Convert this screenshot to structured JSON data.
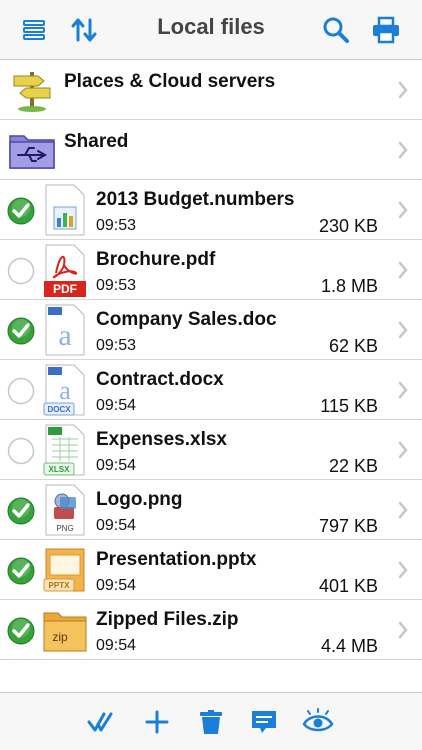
{
  "header": {
    "title": "Local files",
    "left_buttons": [
      "menu-icon",
      "sort-icon"
    ],
    "right_buttons": [
      "search-icon",
      "print-icon"
    ]
  },
  "places": [
    {
      "label": "Places & Cloud servers",
      "icon": "signpost-icon"
    },
    {
      "label": "Shared",
      "icon": "usb-folder-icon"
    }
  ],
  "files": [
    {
      "name": "2013 Budget.numbers",
      "time": "09:53",
      "size": "230 KB",
      "selected": true,
      "type": "numbers"
    },
    {
      "name": "Brochure.pdf",
      "time": "09:53",
      "size": "1.8 MB",
      "selected": false,
      "type": "pdf",
      "badge": "PDF"
    },
    {
      "name": "Company Sales.doc",
      "time": "09:53",
      "size": "62 KB",
      "selected": true,
      "type": "doc"
    },
    {
      "name": "Contract.docx",
      "time": "09:54",
      "size": "115 KB",
      "selected": false,
      "type": "docx",
      "badge": "DOCX"
    },
    {
      "name": "Expenses.xlsx",
      "time": "09:54",
      "size": "22 KB",
      "selected": false,
      "type": "xlsx",
      "badge": "XLSX"
    },
    {
      "name": "Logo.png",
      "time": "09:54",
      "size": "797 KB",
      "selected": true,
      "type": "png",
      "badge": "PNG"
    },
    {
      "name": "Presentation.pptx",
      "time": "09:54",
      "size": "401 KB",
      "selected": true,
      "type": "pptx",
      "badge": "PPTX"
    },
    {
      "name": "Zipped Files.zip",
      "time": "09:54",
      "size": "4.4 MB",
      "selected": true,
      "type": "zip",
      "badge": "zip"
    }
  ],
  "toolbar": [
    "select-all-icon",
    "add-icon",
    "trash-icon",
    "comment-icon",
    "preview-eye-icon"
  ],
  "colors": {
    "accent": "#1a7fd8",
    "check_green": "#35a33a",
    "separator": "#d8d8dc"
  }
}
